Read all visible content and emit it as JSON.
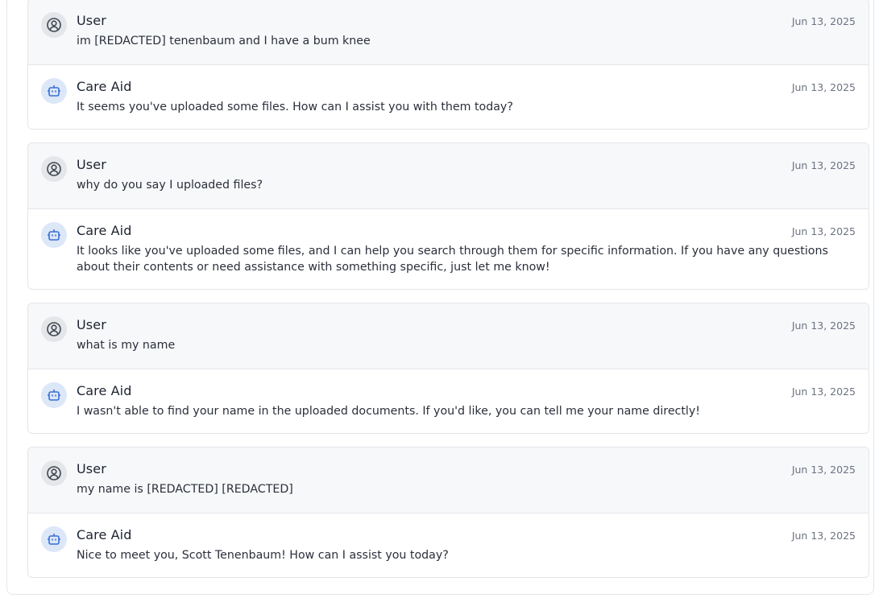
{
  "colors": {
    "user_background": "#f7f8fa",
    "ai_background": "#ffffff",
    "ai_avatar_background": "#dce7f8",
    "ai_icon": "#3b6fd4",
    "user_avatar_background": "#e4e6e9",
    "user_icon": "#3f4650",
    "border": "#e2e5e9"
  },
  "icons": {
    "user": "user-circle-icon",
    "assistant": "robot-icon"
  },
  "conversations": [
    {
      "user": {
        "sender": "User",
        "date": "Jun 13, 2025",
        "text": "im [REDACTED] tenenbaum and I have a bum knee"
      },
      "assistant": {
        "sender": "Care Aid",
        "date": "Jun 13, 2025",
        "text": "It seems you've uploaded some files. How can I assist you with them today?"
      }
    },
    {
      "user": {
        "sender": "User",
        "date": "Jun 13, 2025",
        "text": "why do you say I uploaded files?"
      },
      "assistant": {
        "sender": "Care Aid",
        "date": "Jun 13, 2025",
        "text": "It looks like you've uploaded some files, and I can help you search through them for specific information. If you have any questions about their contents or need assistance with something specific, just let me know!"
      }
    },
    {
      "user": {
        "sender": "User",
        "date": "Jun 13, 2025",
        "text": "what is my name"
      },
      "assistant": {
        "sender": "Care Aid",
        "date": "Jun 13, 2025",
        "text": "I wasn't able to find your name in the uploaded documents. If you'd like, you can tell me your name directly!"
      }
    },
    {
      "user": {
        "sender": "User",
        "date": "Jun 13, 2025",
        "text": "my name is [REDACTED] [REDACTED]"
      },
      "assistant": {
        "sender": "Care Aid",
        "date": "Jun 13, 2025",
        "text": "Nice to meet you, Scott Tenenbaum! How can I assist you today?"
      }
    }
  ]
}
